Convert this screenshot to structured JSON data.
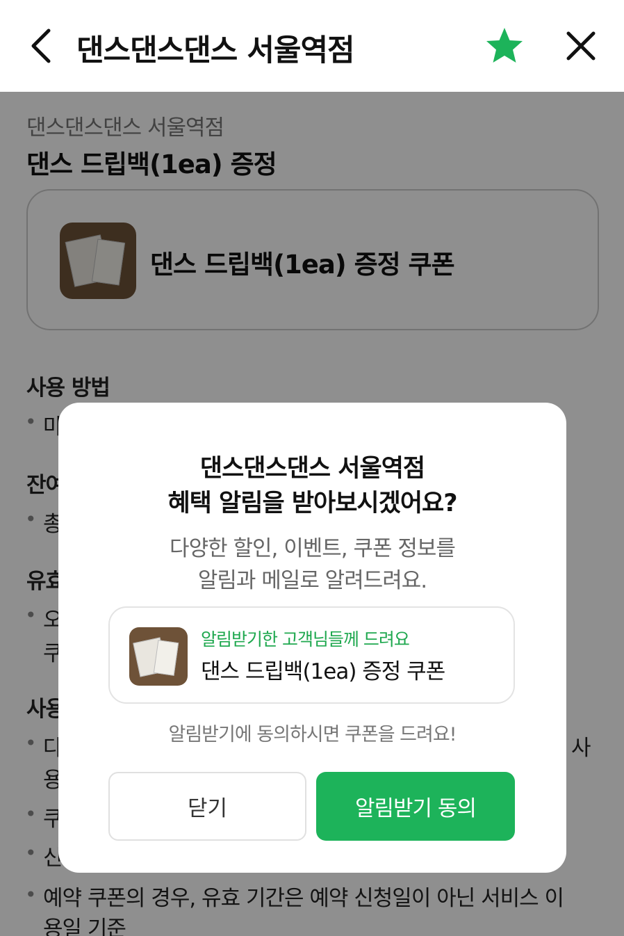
{
  "header": {
    "title": "댄스댄스댄스 서울역점",
    "star_color": "#1db35a"
  },
  "page": {
    "store_name": "댄스댄스댄스 서울역점",
    "coupon_title": "댄스 드립백(1ea) 증정",
    "coupon_card_label": "댄스 드립백(1ea) 증정 쿠폰",
    "sections": {
      "usage": "사용 방법",
      "usage_item": "마",
      "remaining": "잔여",
      "remaining_item": "총",
      "validity": "유효",
      "validity_item1": "오",
      "validity_item2": "쿠",
      "notes": "사용",
      "notes_item1": "다",
      "notes_item1_tail": "사",
      "notes_item1_line2": "용",
      "notes_item2": "쿠",
      "notes_item3": "신",
      "notes_item4_line1": "예약 쿠폰의 경우, 유효 기간은 예약 신청일이 아닌 서비스 이",
      "notes_item4_line2": "용일 기준"
    }
  },
  "modal": {
    "title_line1": "댄스댄스댄스 서울역점",
    "title_line2": "혜택 알림을 받아보시겠어요?",
    "desc_line1": "다양한 할인, 이벤트, 쿠폰 정보를",
    "desc_line2": "알림과 메일로 알려드려요.",
    "card_tagline": "알림받기한 고객님들께 드려요",
    "card_coupon": "댄스 드립백(1ea) 증정 쿠폰",
    "note": "알림받기에 동의하시면 쿠폰을 드려요!",
    "close_label": "닫기",
    "agree_label": "알림받기 동의",
    "accent_color": "#1db35a"
  }
}
